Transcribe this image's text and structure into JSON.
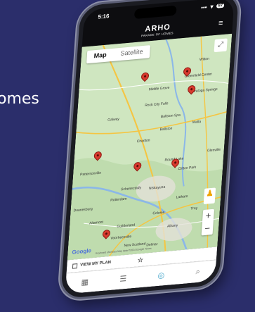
{
  "side_text": "omes",
  "status_bar": {
    "time": "5:16",
    "signal": "•••",
    "wifi": "▼",
    "battery": "87"
  },
  "header": {
    "logo_mark": "ARHO",
    "logo_sub": "PARADE OF HOMES",
    "menu_icon": "≡"
  },
  "map": {
    "tabs": [
      {
        "label": "Map",
        "active": true
      },
      {
        "label": "Satellite",
        "active": false
      }
    ],
    "fullscreen_icon": "⤢",
    "places": [
      {
        "name": "Wilton"
      },
      {
        "name": "Greenfield Center"
      },
      {
        "name": "Middle Grove"
      },
      {
        "name": "Saratoga Springs"
      },
      {
        "name": "Rock City Falls"
      },
      {
        "name": "Galway"
      },
      {
        "name": "Ballston Spa"
      },
      {
        "name": "Ballston"
      },
      {
        "name": "Malta"
      },
      {
        "name": "Charlton"
      },
      {
        "name": "Glenville"
      },
      {
        "name": "Round Lake"
      },
      {
        "name": "Clifton Park"
      },
      {
        "name": "Pattersonville"
      },
      {
        "name": "Schenectady"
      },
      {
        "name": "Rotterdam"
      },
      {
        "name": "Niskayuna"
      },
      {
        "name": "Latham"
      },
      {
        "name": "Duanesburg"
      },
      {
        "name": "Colonie"
      },
      {
        "name": "Troy"
      },
      {
        "name": "Altamont"
      },
      {
        "name": "Guilderland"
      },
      {
        "name": "Albany"
      },
      {
        "name": "Voorheesville"
      },
      {
        "name": "New Scotland"
      },
      {
        "name": "Delmar"
      }
    ],
    "pin_count": 7,
    "pegman_icon": "♟",
    "zoom_in": "+",
    "zoom_out": "−",
    "google_logo": "Google",
    "attribution": "Keyboard shortcuts  Map data ©2024 Google  Terms"
  },
  "plan_row": {
    "label": "VIEW MY PLAN",
    "star_icon": "☆"
  },
  "tab_bar": [
    {
      "icon": "▦",
      "name": "grid"
    },
    {
      "icon": "☰",
      "name": "list"
    },
    {
      "icon": "◎",
      "name": "map-pin"
    },
    {
      "icon": "⌕",
      "name": "search"
    }
  ],
  "colors": {
    "background": "#2b2e6b",
    "pin": "#d83a2e",
    "map_land": "#cfe6c0",
    "active_tab": "#3aa0c8"
  }
}
